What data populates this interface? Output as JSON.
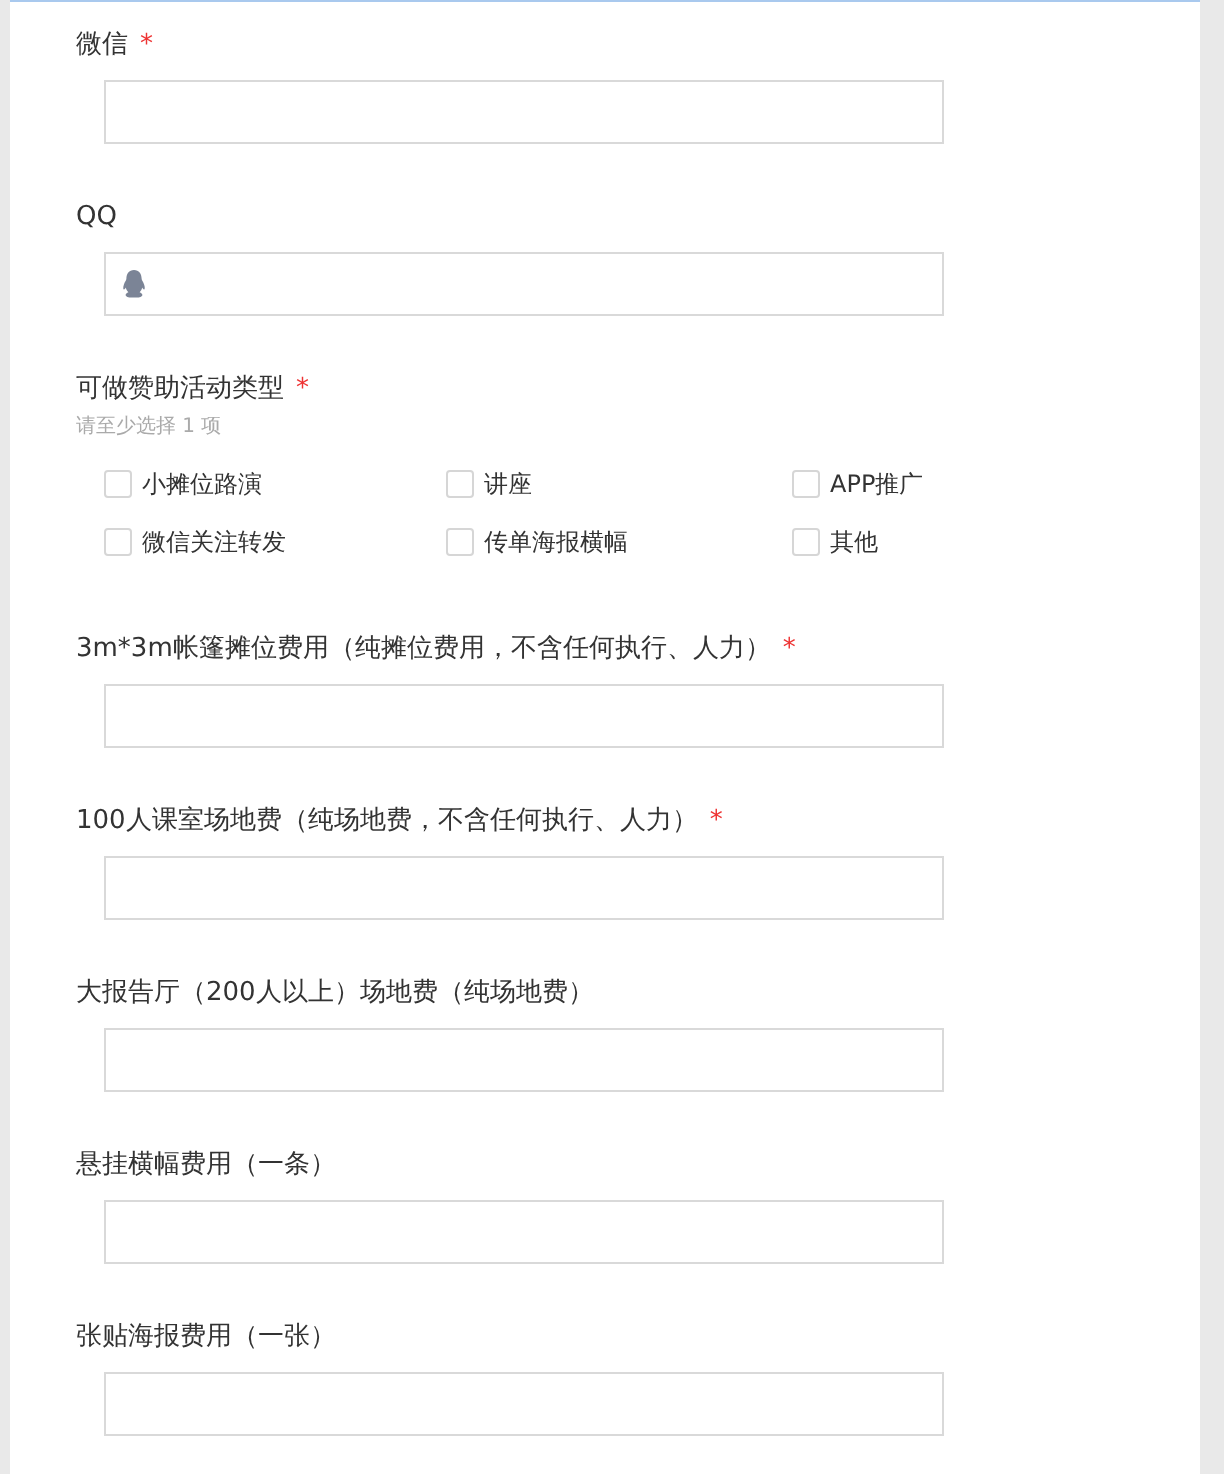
{
  "sections": [
    {
      "kind": "text",
      "label": "微信",
      "required_mark": "*"
    },
    {
      "kind": "qq",
      "label": "QQ"
    },
    {
      "kind": "checkboxes",
      "label": "可做赞助活动类型",
      "required_mark": "*",
      "hint": "请至少选择 1 项",
      "options": [
        {
          "label": "小摊位路演",
          "checked": false
        },
        {
          "label": "讲座",
          "checked": false
        },
        {
          "label": "APP推广",
          "checked": false
        },
        {
          "label": "微信关注转发",
          "checked": false
        },
        {
          "label": "传单海报横幅",
          "checked": false
        },
        {
          "label": "其他",
          "checked": false
        }
      ]
    },
    {
      "kind": "text",
      "label": "3m*3m帐篷摊位费用（纯摊位费用，不含任何执行、人力）",
      "required_mark": "*"
    },
    {
      "kind": "text",
      "label": "100人课室场地费（纯场地费，不含任何执行、人力）",
      "required_mark": "*"
    },
    {
      "kind": "text",
      "label": "大报告厅（200人以上）场地费（纯场地费）"
    },
    {
      "kind": "text",
      "label": "悬挂横幅费用（一条）"
    },
    {
      "kind": "text",
      "label": "张贴海报费用（一张）"
    }
  ]
}
